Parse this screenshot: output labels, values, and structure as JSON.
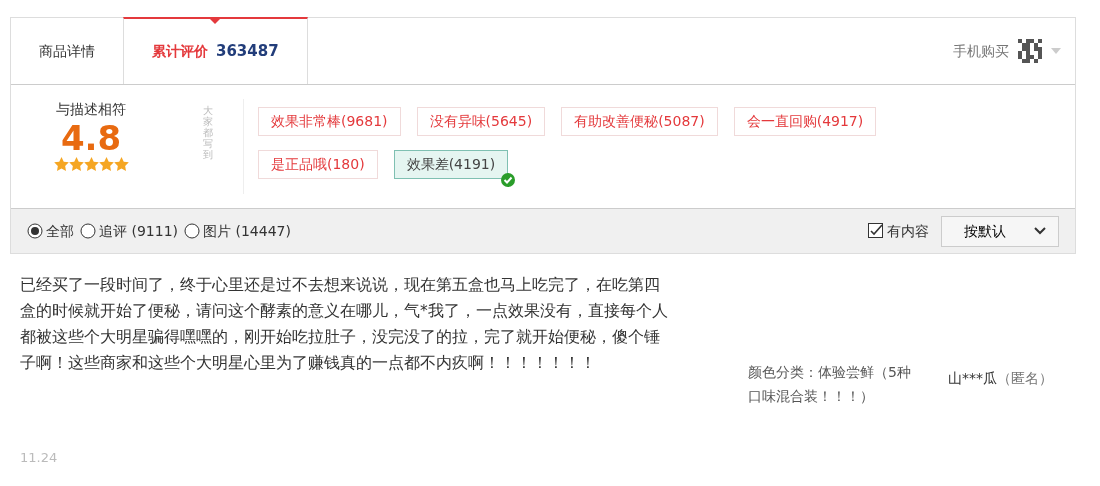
{
  "tabs": [
    {
      "label": "商品详情",
      "selected": false
    },
    {
      "label": "累计评价",
      "count": "363487",
      "selected": true
    }
  ],
  "mobile_buy": {
    "label": "手机购买"
  },
  "summary": {
    "label": "与描述相符",
    "score": "4.8",
    "stars": 5,
    "tags_heading": "大家都写到",
    "tags": [
      {
        "label": "效果非常棒(9681)",
        "selected": false
      },
      {
        "label": "没有异味(5645)",
        "selected": false
      },
      {
        "label": "有助改善便秘(5087)",
        "selected": false
      },
      {
        "label": "会一直回购(4917)",
        "selected": false
      },
      {
        "label": "是正品哦(180)",
        "selected": false
      },
      {
        "label": "效果差(4191)",
        "selected": true
      }
    ]
  },
  "filters": [
    {
      "label": "全部",
      "selected": true
    },
    {
      "label": "追评 (9111)",
      "selected": false
    },
    {
      "label": "图片 (14447)",
      "selected": false
    }
  ],
  "has_content": {
    "label": "有内容",
    "checked": true
  },
  "sort": {
    "value": "按默认"
  },
  "review": {
    "text": "已经买了一段时间了，终于心里还是过不去想来说说，现在第五盒也马上吃完了，在吃第四盒的时候就开始了便秘，请问这个酵素的意义在哪儿，气*我了，一点效果没有，直接每个人都被这些个大明星骗得嘿嘿的，刚开始吃拉肚子，没完没了的拉，完了就开始便秘，傻个锤子啊！这些商家和这些个大明星心里为了赚钱真的一点都不内疚啊！！！！！！！",
    "variant": "颜色分类：体验尝鲜（5种口味混合装！！！）",
    "user": "山***瓜",
    "anon": "（匿名）",
    "date": "11.24"
  }
}
